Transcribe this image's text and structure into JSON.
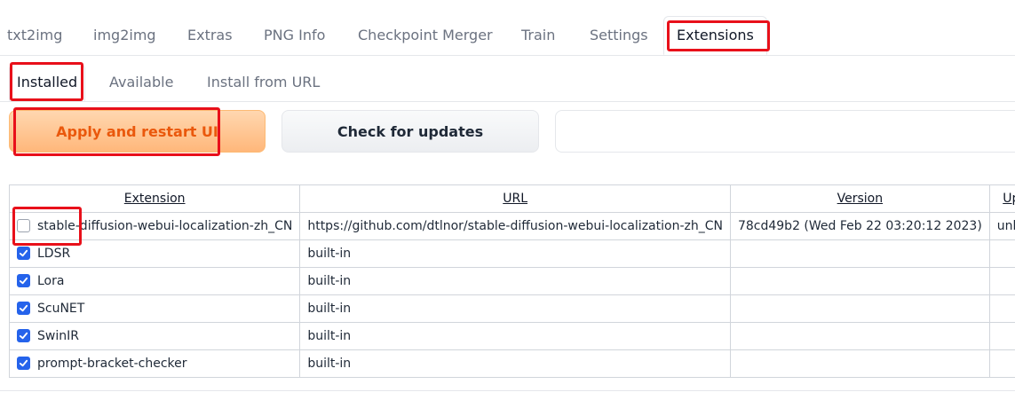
{
  "top_tabs": [
    "txt2img",
    "img2img",
    "Extras",
    "PNG Info",
    "Checkpoint Merger",
    "Train",
    "Settings",
    "Extensions"
  ],
  "sub_tabs": [
    "Installed",
    "Available",
    "Install from URL"
  ],
  "buttons": {
    "apply": "Apply and restart UI",
    "check": "Check for updates"
  },
  "table": {
    "headers": [
      "Extension",
      "URL",
      "Version",
      "Update"
    ],
    "rows": [
      {
        "checked": false,
        "name": "stable-diffusion-webui-localization-zh_CN",
        "url": "https://github.com/dtlnor/stable-diffusion-webui-localization-zh_CN",
        "version": "78cd49b2 (Wed Feb 22 03:20:12 2023)",
        "update": "unknown"
      },
      {
        "checked": true,
        "name": "LDSR",
        "url": "built-in",
        "version": "",
        "update": ""
      },
      {
        "checked": true,
        "name": "Lora",
        "url": "built-in",
        "version": "",
        "update": ""
      },
      {
        "checked": true,
        "name": "ScuNET",
        "url": "built-in",
        "version": "",
        "update": ""
      },
      {
        "checked": true,
        "name": "SwinIR",
        "url": "built-in",
        "version": "",
        "update": ""
      },
      {
        "checked": true,
        "name": "prompt-bracket-checker",
        "url": "built-in",
        "version": "",
        "update": ""
      }
    ]
  },
  "colors": {
    "accent": "#ea580c",
    "checkbox": "#2563eb",
    "highlight": "#e8101a"
  }
}
